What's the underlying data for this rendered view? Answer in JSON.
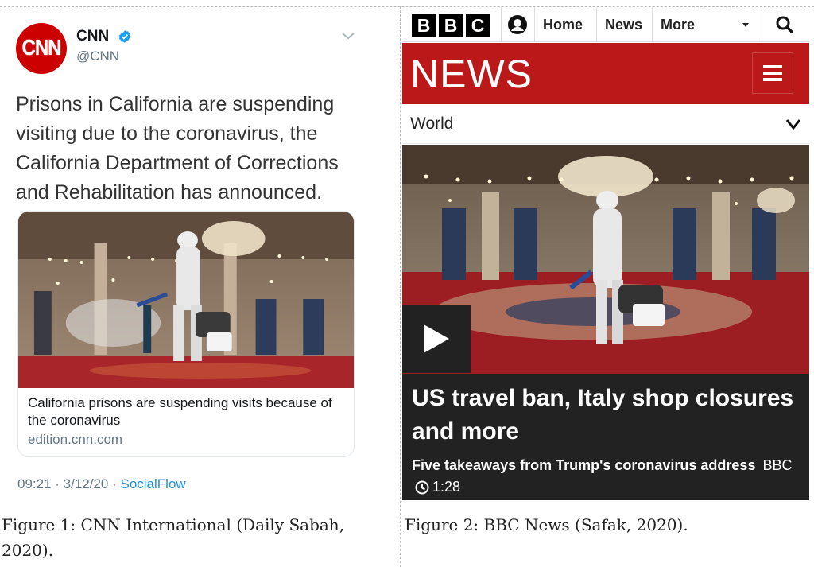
{
  "tweet": {
    "avatar_logo": "CNN",
    "display_name": "CNN",
    "screen_name": "@CNN",
    "verified_icon": "verified-badge-icon",
    "text": "Prisons in California are suspending visiting due to the coronavirus, the California Department of Corrections and Rehabilitation has announced.",
    "card": {
      "title": "California prisons are suspending visits because of the coronavirus",
      "domain": "edition.cnn.com"
    },
    "time": "09:21 · 3/12/20 · ",
    "source": "SocialFlow"
  },
  "captions": {
    "figure1": "Figure 1: CNN International (Daily Sabah, 2020).",
    "figure2": "Figure 2: BBC News (Safak, 2020)."
  },
  "bbc": {
    "logo_letters": [
      "B",
      "B",
      "C"
    ],
    "nav": {
      "home": "Home",
      "news": "News",
      "more": "More"
    },
    "wordmark": "NEWS",
    "section": "World",
    "headline": "US travel ban, Italy shop closures and more",
    "subhead": "Five takeaways from Trump's coronavirus address",
    "source": "BBC",
    "duration": "1:28"
  },
  "colors": {
    "cnn_red": "#cc0000",
    "bbc_red": "#bb1919",
    "twitter_blue": "#1b95e0",
    "headline_bg": "#222222"
  }
}
